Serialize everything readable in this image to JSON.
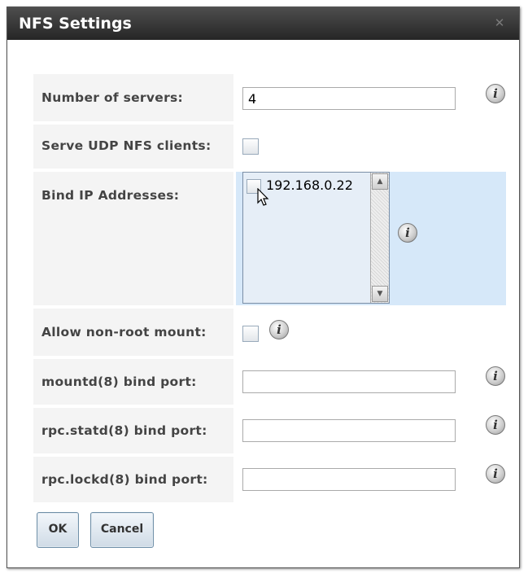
{
  "dialog": {
    "title": "NFS Settings",
    "close_glyph": "✕"
  },
  "fields": {
    "servers": {
      "label": "Number of servers:",
      "value": "4"
    },
    "udp": {
      "label": "Serve UDP NFS clients:",
      "checked": false
    },
    "bind_ip": {
      "label": "Bind IP Addresses:",
      "options": [
        "192.168.0.22"
      ]
    },
    "nonroot": {
      "label": "Allow non-root mount:",
      "checked": false
    },
    "mountd": {
      "label": "mountd(8) bind port:",
      "value": ""
    },
    "statd": {
      "label": "rpc.statd(8) bind port:",
      "value": ""
    },
    "lockd": {
      "label": "rpc.lockd(8) bind port:",
      "value": ""
    }
  },
  "info_glyph": "i",
  "buttons": {
    "ok": "OK",
    "cancel": "Cancel"
  },
  "colors": {
    "titlebar": "#333333",
    "listbox_bg": "#d6e8f9",
    "label_bg": "#f4f4f4"
  }
}
